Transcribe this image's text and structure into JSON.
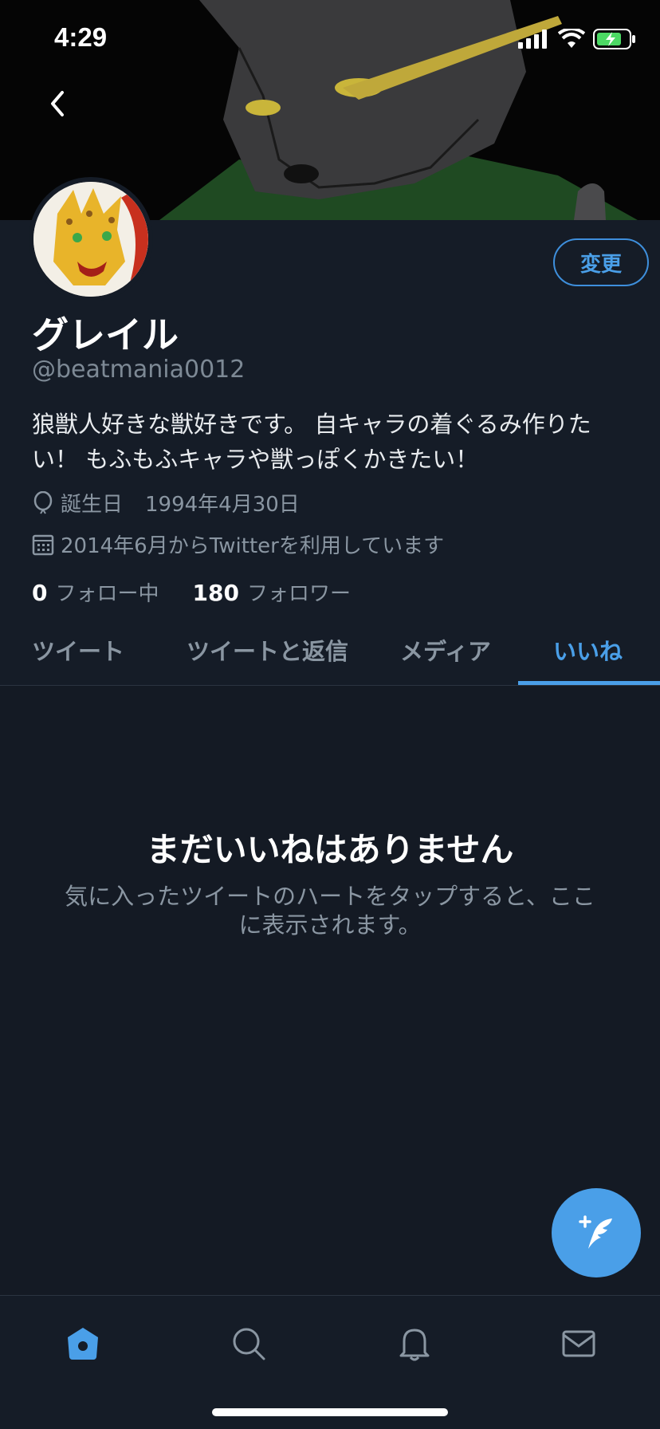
{
  "status_bar": {
    "time": "4:29"
  },
  "profile": {
    "name": "グレイル",
    "handle": "@beatmania0012",
    "bio": "狼獣人好きな獣好きです。 自キャラの着ぐるみ作りたい！ もふもふキャラや獣っぽくかきたい！",
    "birthday_label": "誕生日",
    "birthday_value": "1994年4月30日",
    "joined": "2014年6月からTwitterを利用しています",
    "following_count": "0",
    "following_label": "フォロー中",
    "followers_count": "180",
    "followers_label": "フォロワー",
    "edit_button": "変更"
  },
  "tabs": [
    {
      "label": "ツイート",
      "active": false
    },
    {
      "label": "ツイートと返信",
      "active": false
    },
    {
      "label": "メディア",
      "active": false
    },
    {
      "label": "いいね",
      "active": true
    }
  ],
  "empty_state": {
    "title": "まだいいねはありません",
    "text": "気に入ったツイートのハートをタップすると、ここに表示されます。"
  },
  "bottom_nav": {
    "items": [
      {
        "icon": "home-icon",
        "active": true
      },
      {
        "icon": "search-icon",
        "active": false
      },
      {
        "icon": "bell-icon",
        "active": false
      },
      {
        "icon": "mail-icon",
        "active": false
      }
    ]
  },
  "colors": {
    "accent": "#4a9fe8",
    "background": "#141a24",
    "secondary_text": "#8a96a2"
  }
}
